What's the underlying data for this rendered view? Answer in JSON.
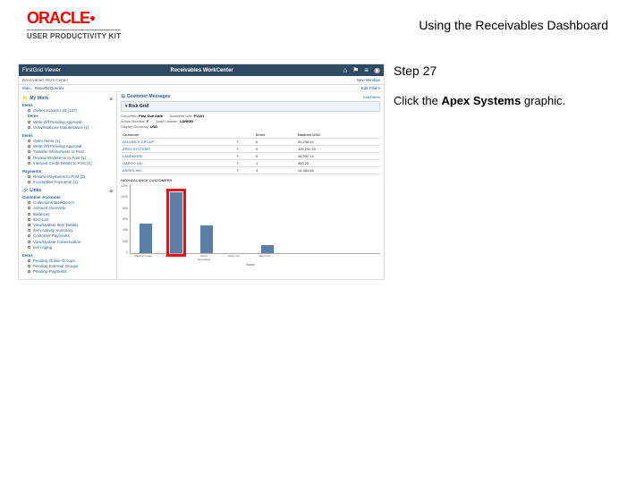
{
  "header": {
    "brand": "ORACLE",
    "kit": "USER PRODUCTIVITY KIT",
    "title": "Using the Receivables Dashboard"
  },
  "instruction": {
    "step": "Step 27",
    "prefix": "Click the ",
    "bold": "Apex Systems",
    "suffix": " graphic."
  },
  "app": {
    "titlebar": {
      "left": "FirstGrid Viewer",
      "center": "Receivables WorkCenter"
    },
    "subbar": {
      "breadcrumb": "Receivables Work Center",
      "right_btn": "New Window"
    },
    "menu": {
      "main": "Main",
      "reports": "Reports/Queries",
      "edit": "Edit Filters"
    },
    "mywork": {
      "title": "My Work"
    },
    "nav": {
      "sec_items": "Items",
      "items": [
        "Owner Actions List (127)",
        "Items",
        "Write-Off Pending Approval",
        "Conversations Maintenance (1)"
      ],
      "sec_items2": "Items",
      "items2": [
        "Open Items (1)",
        "Write-Off Pending Approval",
        "Transfer Worksheets to Post",
        "Review Workitems to Post (1)",
        "Interunit Credit Debits to Post (1)"
      ],
      "sec_payments": "Payments",
      "payments": [
        "Review Payments to Post (2)",
        "Incomplete Payments (1)"
      ],
      "links_title": "Links",
      "sec_cust_accounts": "Customer Accounts",
      "cust_accounts": [
        "Collections Workbench",
        "Account Overview",
        "Balances",
        "Item List",
        "View/Update Item Details",
        "Item Activity Summary",
        "Customer Payments",
        "View/Update Conversation",
        "Item Aging"
      ],
      "sec_items3": "Items",
      "items3": [
        "Pending Online Groups",
        "Pending External Groups",
        "Pending Payments"
      ]
    },
    "right": {
      "title": "11 Customer Messages",
      "filter_btn": "Edit Filters",
      "acc_bar": "Risk Grid",
      "f_corp_label": "Corporate:",
      "f_corp_val": "Past Due Date",
      "f_bu_label": "Business Unit:",
      "f_bu_val": "FV101",
      "f_act_label": "Action Needed:",
      "f_act_val": "Y",
      "f_aud_label": "Audit Listener:",
      "f_aud_val": "LARKIN",
      "f_disp_label": "Display Currency:",
      "f_disp_val": "USD",
      "tbl_hdr": {
        "c1": "Customer",
        "c2": "",
        "c3": "Items",
        "c4": "Balance USD"
      },
      "rows": [
        {
          "cust": "ALLIANCE GROUP",
          "c2": "Y",
          "items": "6",
          "bal": "51,238.53"
        },
        {
          "cust": "APEX SYSTEMS",
          "c2": "Y",
          "items": "9",
          "bal": "105,292.90"
        },
        {
          "cust": "LANDMORE",
          "c2": "Y",
          "items": "5",
          "bal": "46,932.74"
        },
        {
          "cust": "GARCO INC.",
          "c2": "Y",
          "items": "1",
          "bal": "359.25"
        },
        {
          "cust": "ASPEN INC.",
          "c2": "Y",
          "items": "3",
          "bal": "14,384.65"
        }
      ],
      "chart_label": "High Balance Customers",
      "x_axis": "Name",
      "y_label": "Balance"
    }
  },
  "chart_data": {
    "type": "bar",
    "title": "High Balance Customers",
    "xlabel": "Name",
    "ylabel": "Balance",
    "categories": [
      "Alliance Group",
      "Apex Systems",
      "Vertex Associates",
      "Garco Inc.",
      "Aspen Inc."
    ],
    "values": [
      51000,
      105000,
      47000,
      0,
      14000
    ],
    "ylim": [
      0,
      120000
    ],
    "y_ticks": [
      "120K",
      "100K",
      "80K",
      "60K",
      "40K",
      "20K",
      "0"
    ],
    "highlight_index": 1
  }
}
